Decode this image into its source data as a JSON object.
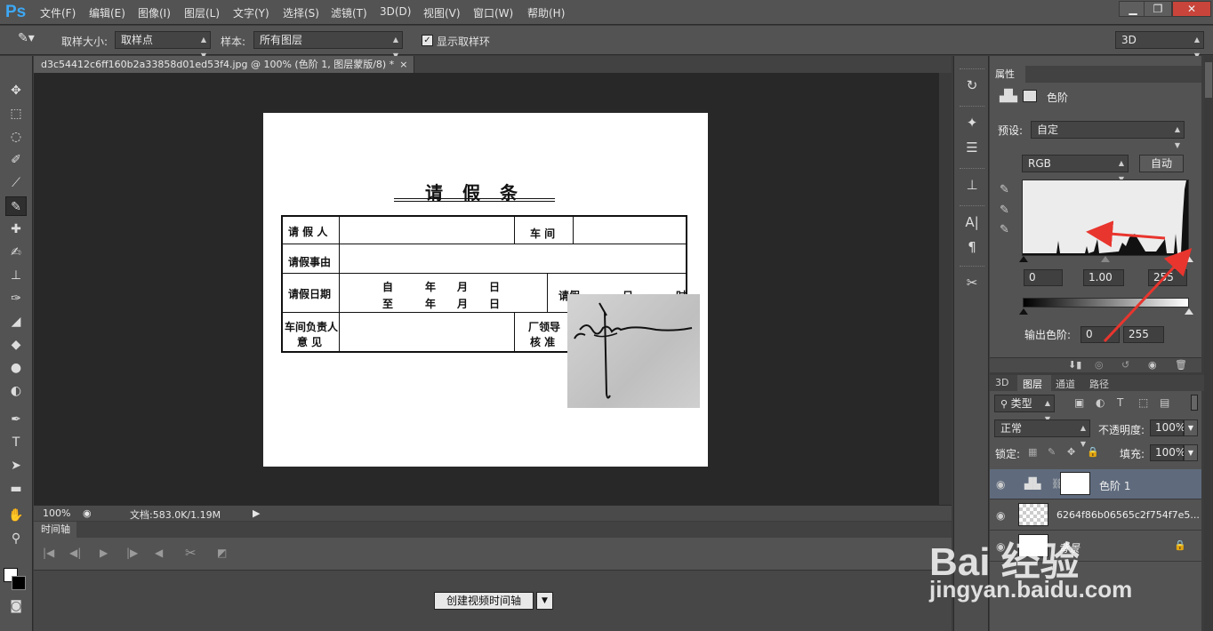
{
  "app": {
    "logo": "Ps",
    "menu": [
      "文件(F)",
      "编辑(E)",
      "图像(I)",
      "图层(L)",
      "文字(Y)",
      "选择(S)",
      "滤镜(T)",
      "3D(D)",
      "视图(V)",
      "窗口(W)",
      "帮助(H)"
    ],
    "window_buttons": [
      "▁",
      "❐",
      "✕"
    ]
  },
  "options": {
    "sample_size_label": "取样大小:",
    "sample_size_value": "取样点",
    "sample_label": "样本:",
    "sample_value": "所有图层",
    "show_ring_label": "显示取样环",
    "show_ring_checked": true,
    "workspace_value": "3D"
  },
  "document": {
    "tab_title": "d3c54412c6ff160b2a33858d01ed53f4.jpg @ 100% (色阶 1, 图层蒙版/8) *",
    "zoom": "100%",
    "doc_size": "文档:583.0K/1.19M",
    "form": {
      "title": "请假条",
      "r1_applicant": "请 假 人",
      "r1_workshop": "车 间",
      "r2_reason": "请假事由",
      "r3_date": "请假日期",
      "r3_from": "自　　　年　　月　　日",
      "r3_to": "至　　　年　　月　　日",
      "r3_right": "请假",
      "r3_right2": "日",
      "r3_right3": "时",
      "r4_manager_1": "车间负责人",
      "r4_manager_2": "意 见",
      "r4_factory_1": "厂领导",
      "r4_factory_2": "核 准"
    }
  },
  "timeline": {
    "tab": "时间轴",
    "create_button": "创建视频时间轴"
  },
  "properties": {
    "tab": "属性",
    "adjustment_name": "色阶",
    "preset_label": "预设:",
    "preset_value": "自定",
    "channel_value": "RGB",
    "auto_button": "自动",
    "input_black": "0",
    "input_gamma": "1.00",
    "input_white": "255",
    "output_label": "输出色阶:",
    "output_black": "0",
    "output_white": "255"
  },
  "layers": {
    "tabs": [
      "3D",
      "图层",
      "通道",
      "路径"
    ],
    "filter_value": "类型",
    "blend_mode": "正常",
    "opacity_label": "不透明度:",
    "opacity_value": "100%",
    "lock_label": "锁定:",
    "fill_label": "填充:",
    "fill_value": "100%",
    "items": [
      {
        "name": "色阶 1"
      },
      {
        "name": "6264f86b06565c2f754f7e5..."
      },
      {
        "name": "背景"
      }
    ]
  },
  "watermark": {
    "brand": "Bai 经验",
    "url": "jingyan.baidu.com"
  }
}
